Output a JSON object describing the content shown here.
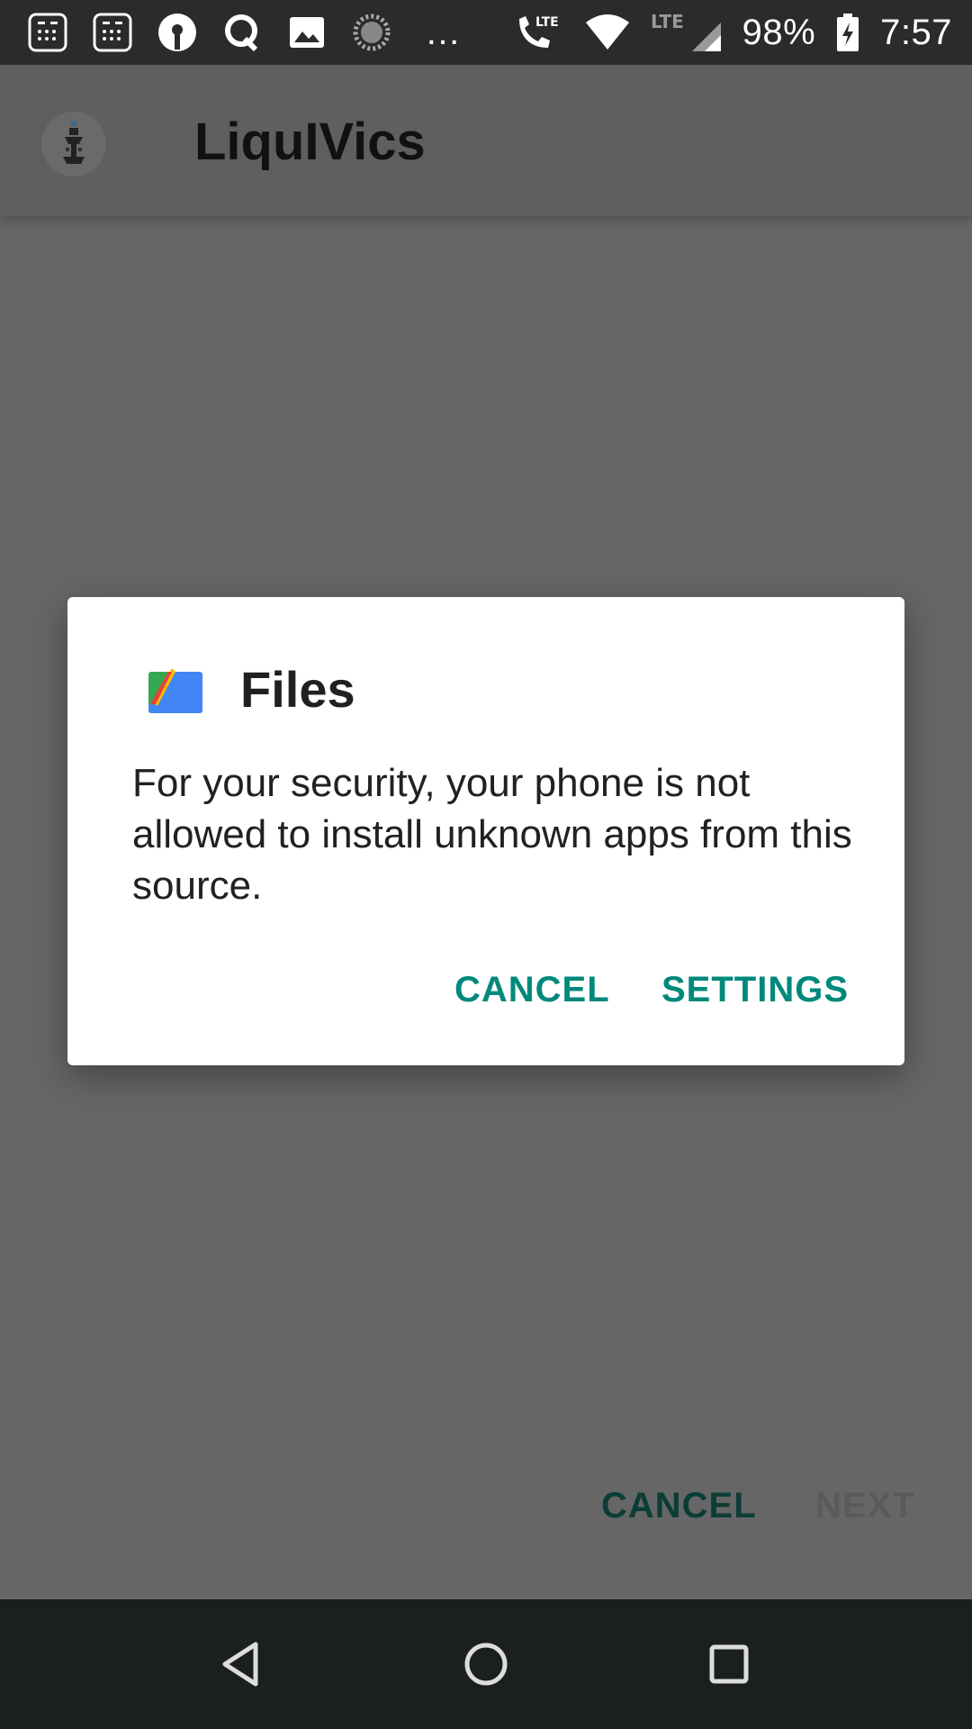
{
  "status_bar": {
    "icons": [
      "calculator-icon",
      "calculator-icon",
      "sbi-icon",
      "q-icon",
      "image-icon",
      "loading-icon",
      "more-icon",
      "lte-call-icon",
      "wifi-icon",
      "lte-signal-icon",
      "battery-charging-icon"
    ],
    "more": "…",
    "battery": "98%",
    "time": "7:57"
  },
  "app_bar": {
    "title": "LiquIVics"
  },
  "background_actions": {
    "cancel_label": "CANCEL",
    "next_label": "NEXT"
  },
  "dialog": {
    "icon": "files-icon",
    "title": "Files",
    "message": "For your security, your phone is not allowed to install unknown apps from this source.",
    "cancel_label": "CANCEL",
    "settings_label": "SETTINGS",
    "accent_color": "#00897b"
  },
  "nav_bar": {
    "buttons": [
      "back-icon",
      "home-icon",
      "recents-icon"
    ]
  }
}
